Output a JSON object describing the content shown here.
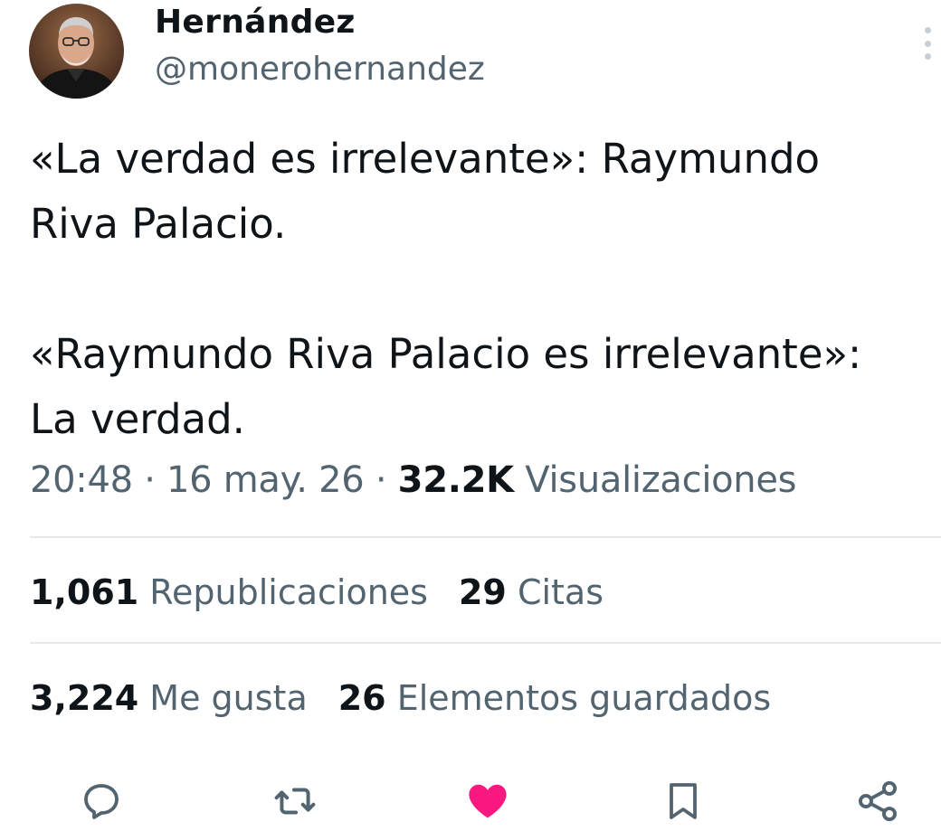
{
  "author": {
    "display_name": "Hernández",
    "handle": "@monerohernandez"
  },
  "tweet": {
    "text": "«La verdad es irrelevante»: Raymundo\nRiva Palacio.\n\n«Raymundo Riva Palacio es irrelevante»:\nLa verdad."
  },
  "meta": {
    "time": "20:48",
    "separator": " · ",
    "date": "16 may. 26",
    "views_count": "32.2K",
    "views_label": "Visualizaciones"
  },
  "stats": {
    "reposts_count": "1,061",
    "reposts_label": "Republicaciones",
    "quotes_count": "29",
    "quotes_label": "Citas",
    "likes_count": "3,224",
    "likes_label": "Me gusta",
    "bookmarks_count": "26",
    "bookmarks_label": "Elementos guardados"
  },
  "icons": {
    "reply": "reply-icon",
    "repost": "repost-icon",
    "like": "heart-icon",
    "bookmark": "bookmark-icon",
    "share": "share-icon",
    "more": "more-vertical-icon"
  },
  "colors": {
    "text_primary": "#0f1419",
    "text_secondary": "#536471",
    "like_active": "#f91880",
    "divider": "#e6e9ec"
  }
}
